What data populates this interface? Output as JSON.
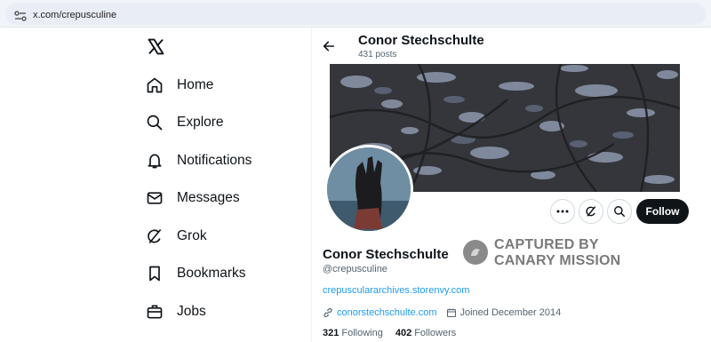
{
  "browser": {
    "url": "x.com/crepusculine"
  },
  "sidebar": {
    "items": [
      {
        "label": "Home"
      },
      {
        "label": "Explore"
      },
      {
        "label": "Notifications"
      },
      {
        "label": "Messages"
      },
      {
        "label": "Grok"
      },
      {
        "label": "Bookmarks"
      },
      {
        "label": "Jobs"
      }
    ]
  },
  "header": {
    "name": "Conor Stechschulte",
    "posts": "431 posts"
  },
  "actions": {
    "follow_label": "Follow"
  },
  "profile": {
    "name": "Conor Stechschulte",
    "handle": "@crepusculine",
    "bio_link": "crepusculararchives.storenvy.com",
    "website": "conorstechschulte.com",
    "joined": "Joined December 2014",
    "following_count": "321",
    "following_label": "Following",
    "followers_count": "402",
    "followers_label": "Followers"
  },
  "watermark": {
    "line1": "CAPTURED BY",
    "line2": "CANARY MISSION"
  },
  "colors": {
    "link": "#1d9bf0",
    "text": "#0f1419",
    "muted": "#536471",
    "follow_bg": "#0f1419"
  }
}
